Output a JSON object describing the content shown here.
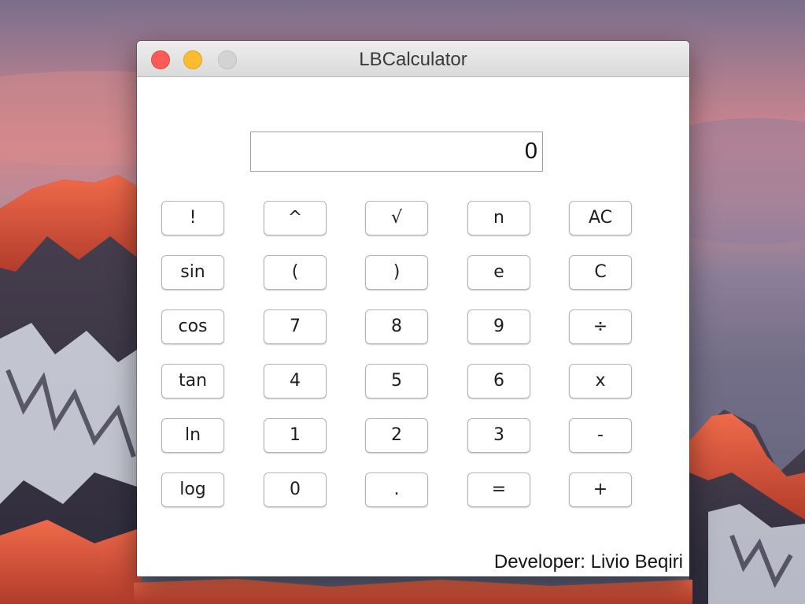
{
  "window": {
    "title": "LBCalculator"
  },
  "display": {
    "value": "0"
  },
  "keypad": {
    "rows": [
      [
        {
          "label": "!",
          "name": "factorial-button"
        },
        {
          "label": "^",
          "name": "power-button"
        },
        {
          "label": "√",
          "name": "square-root-button"
        },
        {
          "label": "n",
          "name": "n-button"
        },
        {
          "label": "AC",
          "name": "all-clear-button"
        }
      ],
      [
        {
          "label": "sin",
          "name": "sin-button"
        },
        {
          "label": "(",
          "name": "open-paren-button"
        },
        {
          "label": ")",
          "name": "close-paren-button"
        },
        {
          "label": "e",
          "name": "euler-button"
        },
        {
          "label": "C",
          "name": "clear-button"
        }
      ],
      [
        {
          "label": "cos",
          "name": "cos-button"
        },
        {
          "label": "7",
          "name": "digit-7-button"
        },
        {
          "label": "8",
          "name": "digit-8-button"
        },
        {
          "label": "9",
          "name": "digit-9-button"
        },
        {
          "label": "÷",
          "name": "divide-button"
        }
      ],
      [
        {
          "label": "tan",
          "name": "tan-button"
        },
        {
          "label": "4",
          "name": "digit-4-button"
        },
        {
          "label": "5",
          "name": "digit-5-button"
        },
        {
          "label": "6",
          "name": "digit-6-button"
        },
        {
          "label": "x",
          "name": "multiply-button"
        }
      ],
      [
        {
          "label": "ln",
          "name": "ln-button"
        },
        {
          "label": "1",
          "name": "digit-1-button"
        },
        {
          "label": "2",
          "name": "digit-2-button"
        },
        {
          "label": "3",
          "name": "digit-3-button"
        },
        {
          "label": "-",
          "name": "subtract-button"
        }
      ],
      [
        {
          "label": "log",
          "name": "log-button"
        },
        {
          "label": "0",
          "name": "digit-0-button"
        },
        {
          "label": ".",
          "name": "decimal-button"
        },
        {
          "label": "=",
          "name": "equals-button"
        },
        {
          "label": "+",
          "name": "add-button"
        }
      ]
    ]
  },
  "footer": {
    "developer_text": "Developer: Livio Beqiri"
  },
  "colors": {
    "close": "#fc5c56",
    "minimize": "#fdbb2e",
    "zoom_disabled": "#d3d3d3"
  }
}
